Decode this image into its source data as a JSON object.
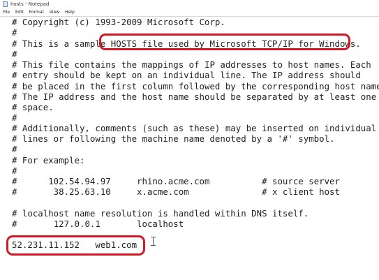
{
  "window": {
    "title": "hosts - Notepad",
    "icon": "notepad-icon"
  },
  "menubar": {
    "items": [
      "File",
      "Edit",
      "Format",
      "View",
      "Help"
    ]
  },
  "document": {
    "lines": [
      "# Copyright (c) 1993-2009 Microsoft Corp.",
      "#",
      "# This is a sample HOSTS file used by Microsoft TCP/IP for Windows.",
      "#",
      "# This file contains the mappings of IP addresses to host names. Each",
      "# entry should be kept on an individual line. The IP address should",
      "# be placed in the first column followed by the corresponding host name.",
      "# The IP address and the host name should be separated by at least one",
      "# space.",
      "#",
      "# Additionally, comments (such as these) may be inserted on individual",
      "# lines or following the machine name denoted by a '#' symbol.",
      "#",
      "# For example:",
      "#",
      "#      102.54.94.97     rhino.acme.com          # source server",
      "#       38.25.63.10     x.acme.com              # x client host",
      "",
      "# localhost name resolution is handled within DNS itself.",
      "#\t127.0.0.1       localhost",
      "",
      "52.231.11.152   web1.com"
    ]
  },
  "annotations": {
    "color": "#d11a26"
  },
  "pointer": {
    "icon": "text-cursor-icon"
  }
}
